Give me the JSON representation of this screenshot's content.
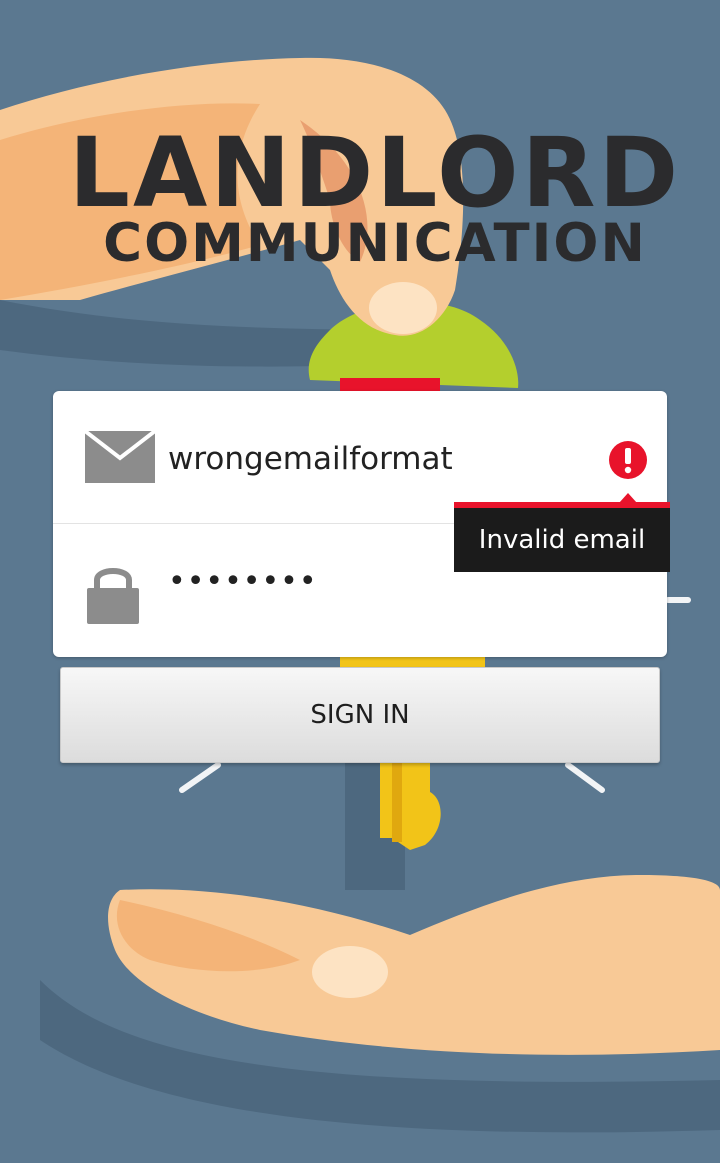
{
  "app": {
    "title_line_1": "LANDLORD",
    "title_line_2": "COMMUNICATION"
  },
  "login": {
    "email": {
      "icon": "envelope-icon",
      "value": "wrongemailformat",
      "error_icon": "error-exclamation-icon",
      "error_message": "Invalid email"
    },
    "password": {
      "icon": "lock-icon",
      "masked_value": "••••••••"
    },
    "sign_in_label": "SIGN IN"
  },
  "colors": {
    "background": "#5b7890",
    "error": "#e8132b",
    "tooltip_background": "#1b1b1b",
    "key_yellow": "#f2c418",
    "key_green": "#b4cf2d",
    "skin": "#f8c996"
  }
}
